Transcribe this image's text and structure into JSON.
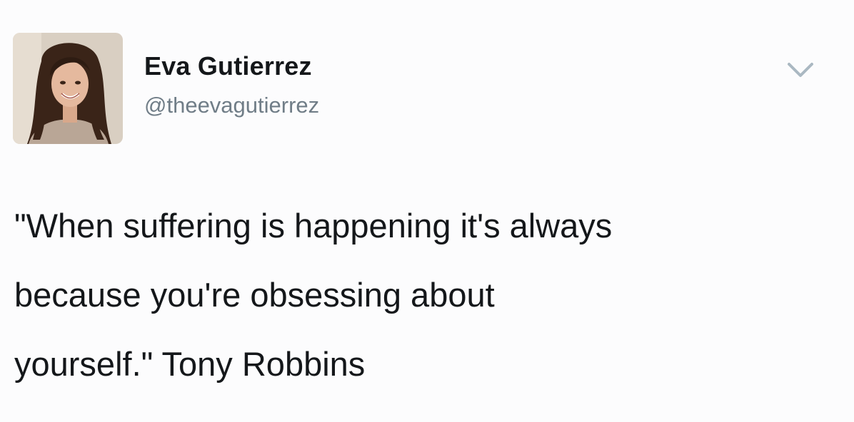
{
  "tweet": {
    "author": {
      "display_name": "Eva Gutierrez",
      "handle": "@theevagutierrez",
      "avatar": "profile-photo"
    },
    "menu_icon": "chevron-down-icon",
    "text_lines": [
      "\"When suffering is happening it's always",
      "because you're obsessing about",
      "yourself.\" Tony Robbins"
    ],
    "colors": {
      "text": "#14171a",
      "handle": "#707d87",
      "chevron": "#aab8c2",
      "background": "#fcfcfd"
    }
  }
}
